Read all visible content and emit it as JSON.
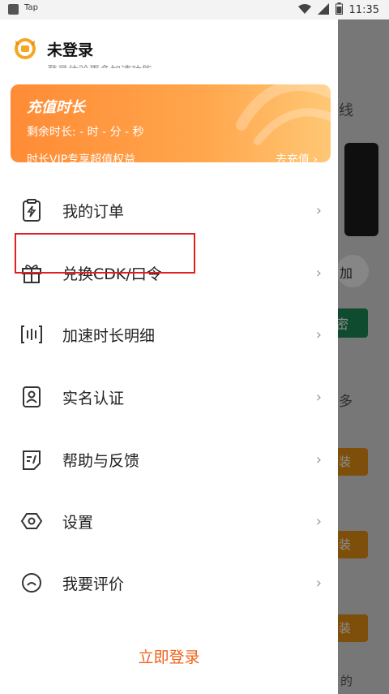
{
  "status_bar": {
    "app_name": "Tap",
    "time": "11:35"
  },
  "background": {
    "partial_text_1": "线",
    "partial_button_white": "加",
    "partial_green": "密",
    "partial_more": "多",
    "partial_orange": [
      "装",
      "装",
      "装"
    ],
    "partial_bottom": "的"
  },
  "user": {
    "name": "未登录",
    "subline": "登录体验更多加速功能"
  },
  "vip": {
    "title": "充值时长",
    "remaining": "剩余时长: - 时 - 分 - 秒",
    "benefit": "时长VIP专享超值权益",
    "cta": "去充值 ›"
  },
  "menu": {
    "items": [
      {
        "label": "我的订单",
        "icon": "clipboard-bolt-icon"
      },
      {
        "label": "兑换CDK/口令",
        "icon": "gift-icon"
      },
      {
        "label": "加速时长明细",
        "icon": "speed-bars-icon"
      },
      {
        "label": "实名认证",
        "icon": "id-card-icon"
      },
      {
        "label": "帮助与反馈",
        "icon": "feedback-doc-icon"
      },
      {
        "label": "设置",
        "icon": "hexagon-settings-icon"
      },
      {
        "label": "我要评价",
        "icon": "face-icon"
      }
    ],
    "chevron": "›"
  },
  "login_label": "立即登录",
  "colors": {
    "accent_orange": "#f06018",
    "highlight_red": "#e02020"
  }
}
